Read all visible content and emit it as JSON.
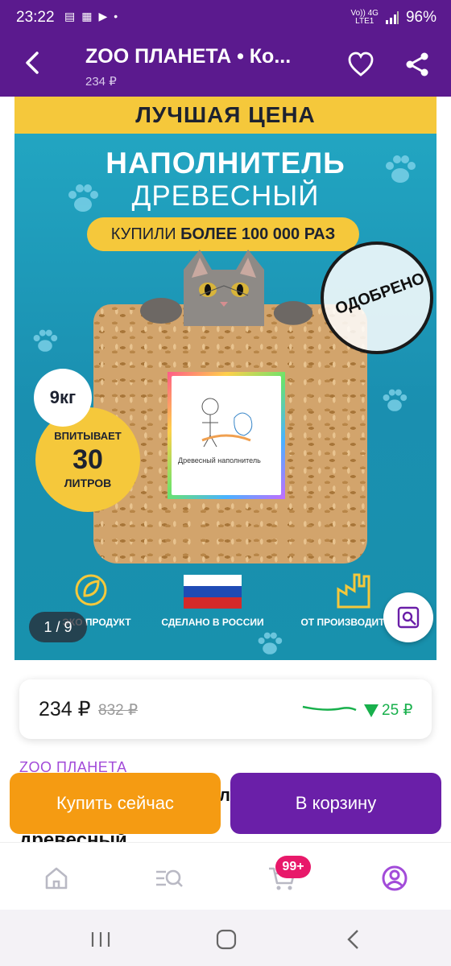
{
  "status_bar": {
    "time": "23:22",
    "network_line1": "Vo)) 4G",
    "network_line2": "LTE1",
    "battery": "96%"
  },
  "app_bar": {
    "title": "ZOO ПЛАНЕТА • Ко...",
    "subtitle": "234 ₽"
  },
  "product_image": {
    "banner": "ЛУЧШАЯ ЦЕНА",
    "headline_1": "НАПОЛНИТЕЛЬ",
    "headline_2": "ДРЕВЕСНЫЙ",
    "bought_prefix": "КУПИЛИ ",
    "bought_bold": "БОЛЕЕ 100 000 РАЗ",
    "stamp_text": "ОДОБРЕНО",
    "weight": "9кг",
    "absorb_1": "ВПИТЫВАЕТ",
    "absorb_2": "30",
    "absorb_3": "ЛИТРОВ",
    "bag_label_text": "Древесный наполнитель",
    "feature_1": "ЭКО ПРОДУКТ",
    "feature_2": "СДЕЛАНО В РОССИИ",
    "feature_3": "ОТ ПРОИЗВОДИТЕЛЯ",
    "counter": "1 / 9"
  },
  "price": {
    "current": "234 ₽",
    "old": "832 ₽",
    "drop": "25 ₽",
    "accent_green": "#18b04c"
  },
  "product": {
    "brand": "ZOO ПЛАНЕТА",
    "title_peek": "л",
    "title_clip": "древесный"
  },
  "actions": {
    "buy_now": "Купить сейчас",
    "add_to_cart": "В корзину"
  },
  "bottom_nav": {
    "cart_badge": "99+",
    "items": [
      "home-icon",
      "catalog-search-icon",
      "cart-icon",
      "profile-icon"
    ]
  },
  "colors": {
    "primary_purple": "#6a1fa8",
    "orange": "#f59b12",
    "badge_pink": "#e8196a"
  }
}
